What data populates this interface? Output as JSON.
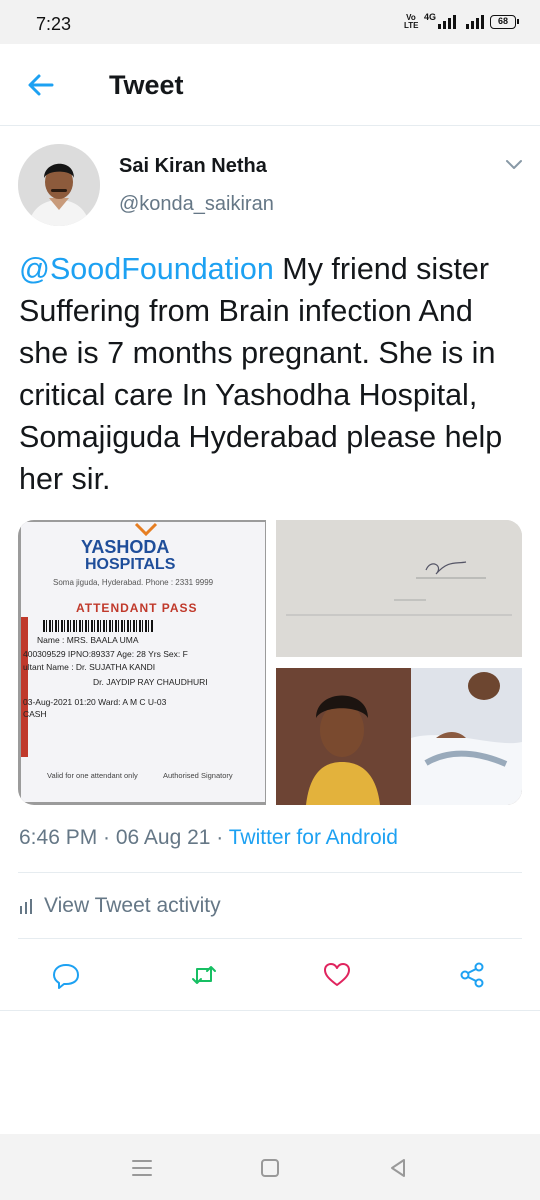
{
  "status_bar": {
    "time": "7:23",
    "volte": "Vo LTE",
    "network": "4G",
    "battery": "68"
  },
  "header": {
    "back_icon": "arrow-left-icon",
    "title": "Tweet"
  },
  "tweet": {
    "author_name": "Sai Kiran Netha",
    "author_handle": "@konda_saikiran",
    "mention": "@SoodFoundation",
    "body": " My friend sister Suffering from Brain infection And she is 7 months pregnant. She is in critical care In Yashodha Hospital, Somajiguda Hyderabad please help her sir.",
    "timestamp": "6:46 PM · 06 Aug 21 · ",
    "source": "Twitter for Android",
    "activity_label": "View Tweet activity"
  },
  "media": {
    "pass": {
      "hospital_line1": "YASHODA",
      "hospital_line2": "HOSPITALS",
      "address": "Soma jiguda, Hyderabad. Phone : 2331 9999",
      "heading": "ATTENDANT PASS",
      "name_line": "Name :  MRS. BAALA UMA",
      "id_line": "400309529   IPNO:89337   Age: 28 Yrs   Sex: F",
      "consultant_line": "ultant Name :   Dr. SUJATHA KANDI",
      "doctor_line": "Dr.  JAYDIP RAY CHAUDHURI",
      "date_line": "03-Aug-2021   01:20    Ward: A M C U-03",
      "payment_line": "CASH",
      "footer_left": "Valid for one attendant only",
      "footer_right": "Authorised Signatory"
    }
  },
  "actions": {
    "reply_icon": "comment-icon",
    "retweet_icon": "retweet-icon",
    "like_icon": "heart-icon",
    "share_icon": "share-icon"
  },
  "colors": {
    "accent": "#1da1f2",
    "secondary_text": "#657786",
    "primary_text": "#14171a"
  }
}
